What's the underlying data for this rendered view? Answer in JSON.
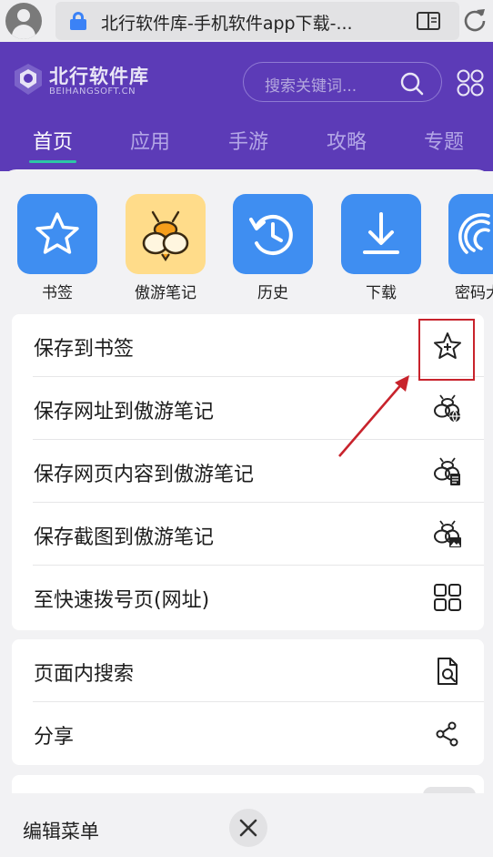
{
  "browser": {
    "url_title": "北行软件库-手机软件app下载-...",
    "icons": [
      "avatar-icon",
      "lock-icon",
      "reader-mode-icon",
      "reload-icon"
    ]
  },
  "site": {
    "logo_title": "北行软件库",
    "logo_subtitle": "BEIHANGSOFT.CN",
    "search_placeholder": "搜索关键词...",
    "nav_tabs": [
      {
        "label": "首页",
        "active": true
      },
      {
        "label": "应用",
        "active": false
      },
      {
        "label": "手游",
        "active": false
      },
      {
        "label": "攻略",
        "active": false
      },
      {
        "label": "专题",
        "active": false
      }
    ],
    "colors": {
      "header_bg": "#5c3bb7",
      "tab_indicator": "#2cc7a6"
    }
  },
  "quick_actions": [
    {
      "label": "书签",
      "icon": "star-icon"
    },
    {
      "label": "傲游笔记",
      "icon": "bee-icon"
    },
    {
      "label": "历史",
      "icon": "history-icon"
    },
    {
      "label": "下载",
      "icon": "download-icon"
    },
    {
      "label": "密码大",
      "icon": "fingerprint-icon"
    }
  ],
  "menu_group1": [
    {
      "label": "保存到书签",
      "icon": "star-plus-icon"
    },
    {
      "label": "保存网址到傲游笔记",
      "icon": "bee-globe-icon"
    },
    {
      "label": "保存网页内容到傲游笔记",
      "icon": "bee-document-icon"
    },
    {
      "label": "保存截图到傲游笔记",
      "icon": "bee-image-icon"
    },
    {
      "label": "至快速拨号页(网址)",
      "icon": "speed-dial-grid-icon"
    }
  ],
  "menu_group2": [
    {
      "label": "页面内搜索",
      "icon": "find-in-page-icon"
    },
    {
      "label": "分享",
      "icon": "share-icon"
    }
  ],
  "bottom": {
    "edit_menu": "编辑菜单",
    "close_icon": "close-icon"
  },
  "annotation": {
    "highlight_color": "#c8232c",
    "target": "star-plus-icon"
  }
}
